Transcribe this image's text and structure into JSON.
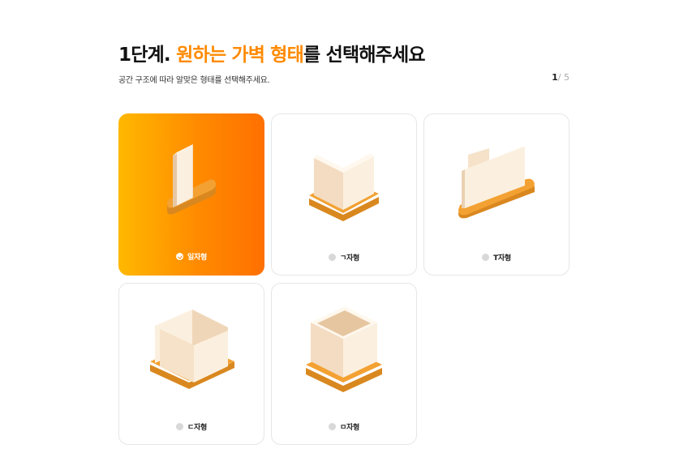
{
  "header": {
    "title_prefix": "1단계.",
    "title_accent": "원하는 가벽 형태",
    "title_suffix": "를 선택해주세요",
    "subtitle": "공간 구조에 따라 알맞은 형태를 선택해주세요.",
    "page_current": "1",
    "page_separator": "/",
    "page_total": "5"
  },
  "colors": {
    "accent": "#ff8a00",
    "wall": "#fbf0df",
    "base": "#f3a132"
  },
  "options": [
    {
      "label": "일자형",
      "icon": "straight-wall-icon",
      "selected": true
    },
    {
      "label": "ㄱ자형",
      "icon": "l-shaped-wall-icon",
      "selected": false
    },
    {
      "label": "T자형",
      "icon": "t-shaped-wall-icon",
      "selected": false
    },
    {
      "label": "ㄷ자형",
      "icon": "u-shaped-wall-icon",
      "selected": false
    },
    {
      "label": "ㅁ자형",
      "icon": "square-wall-icon",
      "selected": false
    }
  ]
}
